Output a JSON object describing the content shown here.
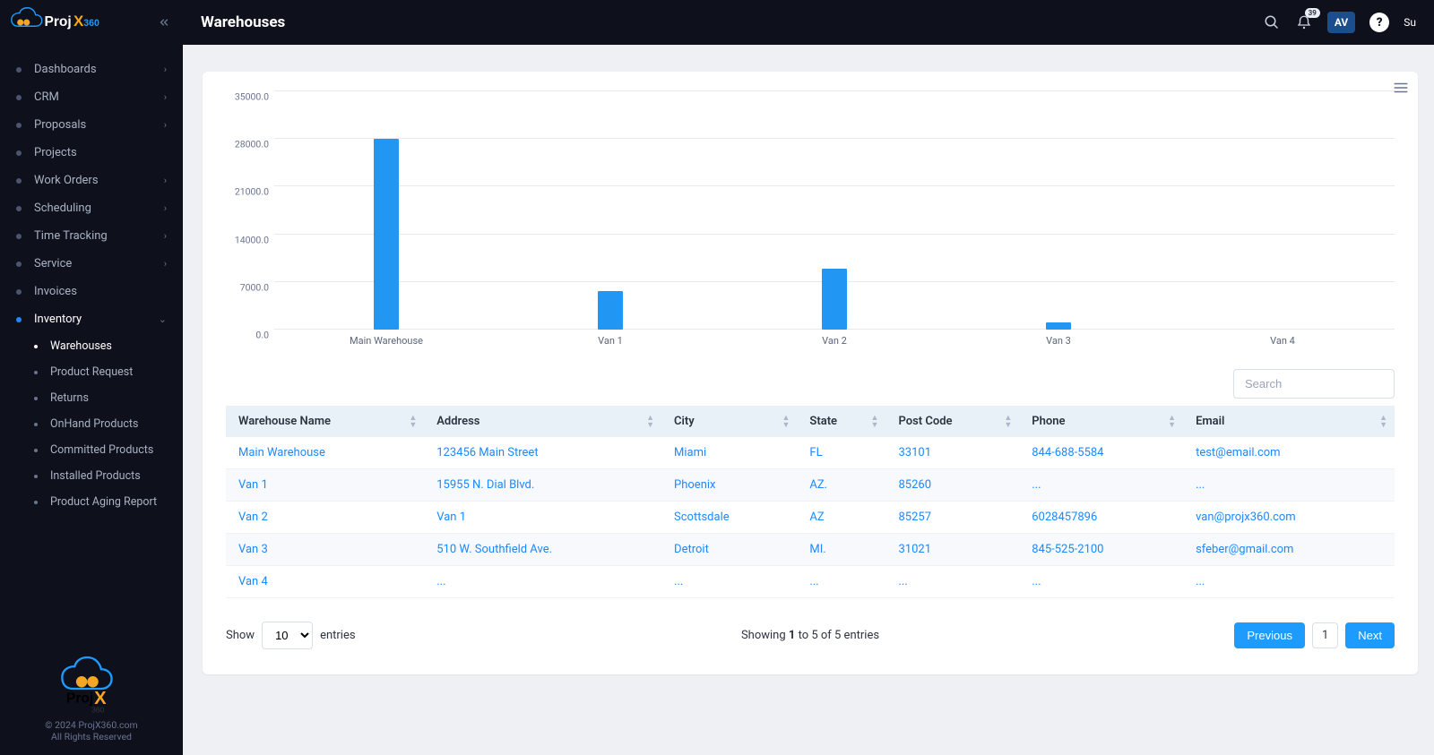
{
  "brand": {
    "name": "ProjX360"
  },
  "header": {
    "title": "Warehouses",
    "notif_count": "39",
    "avatar": "AV",
    "support_label": "Su"
  },
  "sidebar": {
    "items": [
      {
        "label": "Dashboards",
        "has_children": true
      },
      {
        "label": "CRM",
        "has_children": true
      },
      {
        "label": "Proposals",
        "has_children": true
      },
      {
        "label": "Projects",
        "has_children": false
      },
      {
        "label": "Work Orders",
        "has_children": true
      },
      {
        "label": "Scheduling",
        "has_children": true
      },
      {
        "label": "Time Tracking",
        "has_children": true
      },
      {
        "label": "Service",
        "has_children": true
      },
      {
        "label": "Invoices",
        "has_children": false
      },
      {
        "label": "Inventory",
        "has_children": true,
        "active": true,
        "expanded": true
      }
    ],
    "inventory_children": [
      {
        "label": "Warehouses",
        "active": true
      },
      {
        "label": "Product Request"
      },
      {
        "label": "Returns"
      },
      {
        "label": "OnHand Products"
      },
      {
        "label": "Committed Products"
      },
      {
        "label": "Installed Products"
      },
      {
        "label": "Product Aging Report"
      }
    ],
    "footer": {
      "copyright": "© 2024 ProjX360.com",
      "rights": "All Rights Reserved"
    }
  },
  "chart_data": {
    "type": "bar",
    "categories": [
      "Main Warehouse",
      "Van 1",
      "Van 2",
      "Van 3",
      "Van 4"
    ],
    "values": [
      28000,
      5700,
      9000,
      1100,
      0
    ],
    "y_ticks": [
      "0.0",
      "7000.0",
      "14000.0",
      "21000.0",
      "28000.0",
      "35000.0"
    ],
    "ylim": [
      0,
      35000
    ],
    "bar_color": "#2196f3"
  },
  "search": {
    "placeholder": "Search"
  },
  "table": {
    "columns": [
      "Warehouse Name",
      "Address",
      "City",
      "State",
      "Post Code",
      "Phone",
      "Email"
    ],
    "rows": [
      {
        "name": "Main Warehouse",
        "address": "123456 Main Street",
        "city": "Miami",
        "state": "FL",
        "post": "33101",
        "phone": "844-688-5584",
        "email": "test@email.com"
      },
      {
        "name": "Van 1",
        "address": "15955 N. Dial Blvd.",
        "city": "Phoenix",
        "state": "AZ.",
        "post": "85260",
        "phone": "...",
        "email": "..."
      },
      {
        "name": "Van 2",
        "address": "Van 1",
        "city": "Scottsdale",
        "state": "AZ",
        "post": "85257",
        "phone": "6028457896",
        "email": "van@projx360.com"
      },
      {
        "name": "Van 3",
        "address": "510 W. Southfield Ave.",
        "city": "Detroit",
        "state": "MI.",
        "post": "31021",
        "phone": "845-525-2100",
        "email": "sfeber@gmail.com"
      },
      {
        "name": "Van 4",
        "address": "...",
        "city": "...",
        "state": "...",
        "post": "...",
        "phone": "...",
        "email": "..."
      }
    ]
  },
  "table_footer": {
    "show_label": "Show",
    "entries_label": "entries",
    "page_size": "10",
    "result_prefix": "Showing ",
    "result_bold1": "1",
    "result_mid": " to 5 of 5 entries",
    "prev": "Previous",
    "next": "Next",
    "current_page": "1"
  }
}
